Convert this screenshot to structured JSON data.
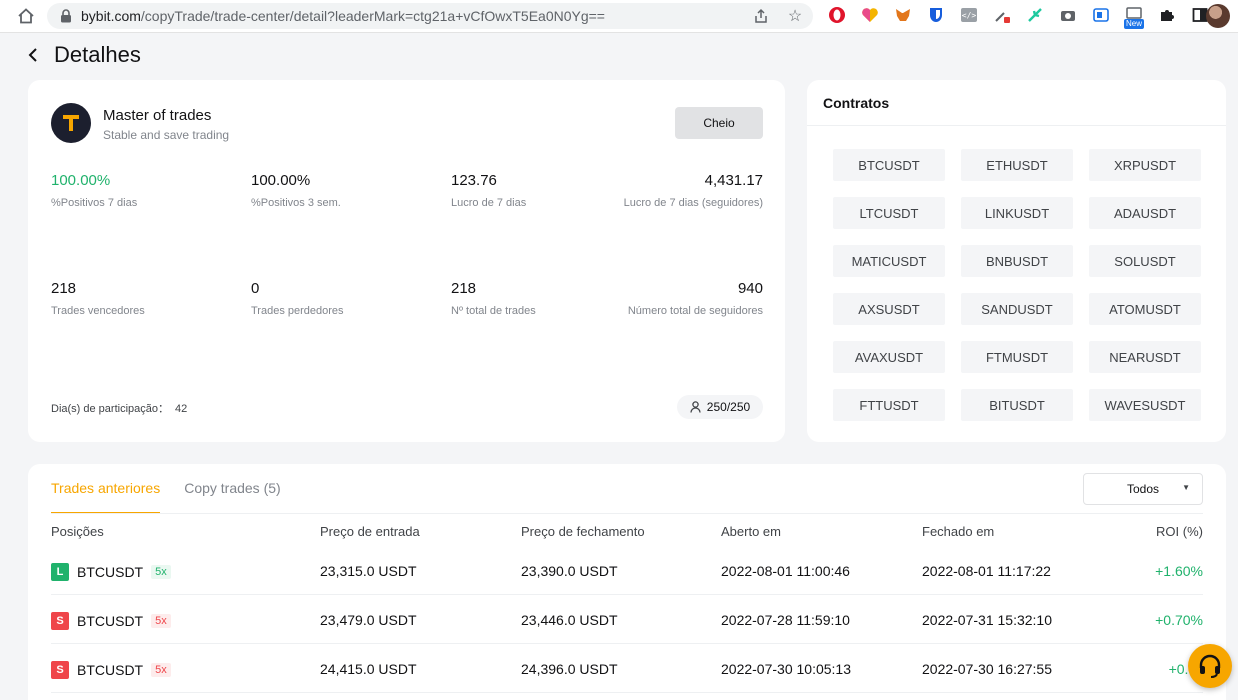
{
  "browser": {
    "url_host": "bybit.com",
    "url_path": "/copyTrade/trade-center/detail?leaderMark=ctg21a+vCfOwxT5Ea0N0Yg==",
    "new_badge": "New"
  },
  "page": {
    "title": "Detalhes"
  },
  "leader": {
    "name": "Master of trades",
    "description": "Stable and save trading",
    "full_button": "Cheio",
    "stats": [
      {
        "value": "100.00%",
        "label": "%Positivos 7 dias"
      },
      {
        "value": "100.00%",
        "label": "%Positivos 3 sem."
      },
      {
        "value": "123.76",
        "label": "Lucro de 7 dias"
      },
      {
        "value": "4,431.17",
        "label": "Lucro de 7 dias (seguidores)"
      },
      {
        "value": "218",
        "label": "Trades vencedores"
      },
      {
        "value": "0",
        "label": "Trades perdedores"
      },
      {
        "value": "218",
        "label": "Nº total de trades"
      },
      {
        "value": "940",
        "label": "Número total de seguidores"
      }
    ],
    "days_label": "Dia(s) de participação：",
    "days_value": "42",
    "seats": "250/250",
    "colors": {
      "positive": "#20b26c",
      "negative": "#ef454a",
      "accent": "#f7a600"
    }
  },
  "contracts": {
    "title": "Contratos",
    "pairs": [
      "BTCUSDT",
      "ETHUSDT",
      "XRPUSDT",
      "LTCUSDT",
      "LINKUSDT",
      "ADAUSDT",
      "MATICUSDT",
      "BNBUSDT",
      "SOLUSDT",
      "AXSUSDT",
      "SANDUSDT",
      "ATOMUSDT",
      "AVAXUSDT",
      "FTMUSDT",
      "NEARUSDT",
      "FTTUSDT",
      "BITUSDT",
      "WAVESUSDT"
    ]
  },
  "history": {
    "tabs": [
      "Trades anteriores",
      "Copy trades (5)"
    ],
    "filter": "Todos",
    "columns": [
      "Posições",
      "Preço de entrada",
      "Preço de fechamento",
      "Aberto em",
      "Fechado em",
      "ROI (%)"
    ],
    "rows": [
      {
        "side": "L",
        "symbol": "BTCUSDT",
        "leverage": "5x",
        "entry": "23,315.0 USDT",
        "close": "23,390.0 USDT",
        "opened": "2022-08-01 11:00:46",
        "closed": "2022-08-01 11:17:22",
        "roi": "+1.60%"
      },
      {
        "side": "S",
        "symbol": "BTCUSDT",
        "leverage": "5x",
        "entry": "23,479.0 USDT",
        "close": "23,446.0 USDT",
        "opened": "2022-07-28 11:59:10",
        "closed": "2022-07-31 15:32:10",
        "roi": "+0.70%"
      },
      {
        "side": "S",
        "symbol": "BTCUSDT",
        "leverage": "5x",
        "entry": "24,415.0 USDT",
        "close": "24,396.0 USDT",
        "opened": "2022-07-30 10:05:13",
        "closed": "2022-07-30 16:27:55",
        "roi": "+0.38"
      }
    ]
  }
}
